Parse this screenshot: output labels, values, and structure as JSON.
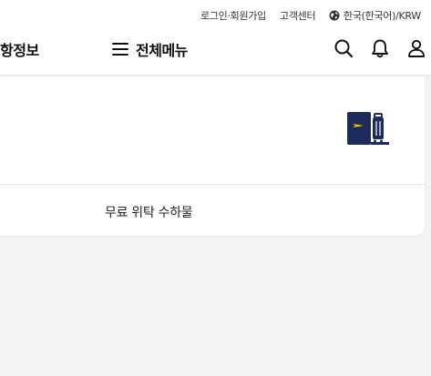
{
  "utility": {
    "login_signup": "로그인·회원가입",
    "customer_center": "고객센터",
    "language": "한국(한국어)/KRW"
  },
  "nav": {
    "prev_item_partial": "항정보",
    "menu_label": "전체메뉴"
  },
  "icons": {
    "language": "globe-icon",
    "menu": "hamburger-icon",
    "search": "search-icon",
    "notifications": "bell-icon",
    "account": "user-icon",
    "baggage": "checked-baggage-icon"
  },
  "card": {
    "baggage_label": "무료 위탁 수하물"
  },
  "colors": {
    "brand_navy": "#1d2b5b",
    "brand_yellow": "#f5d000",
    "background": "#f2f3f5"
  }
}
